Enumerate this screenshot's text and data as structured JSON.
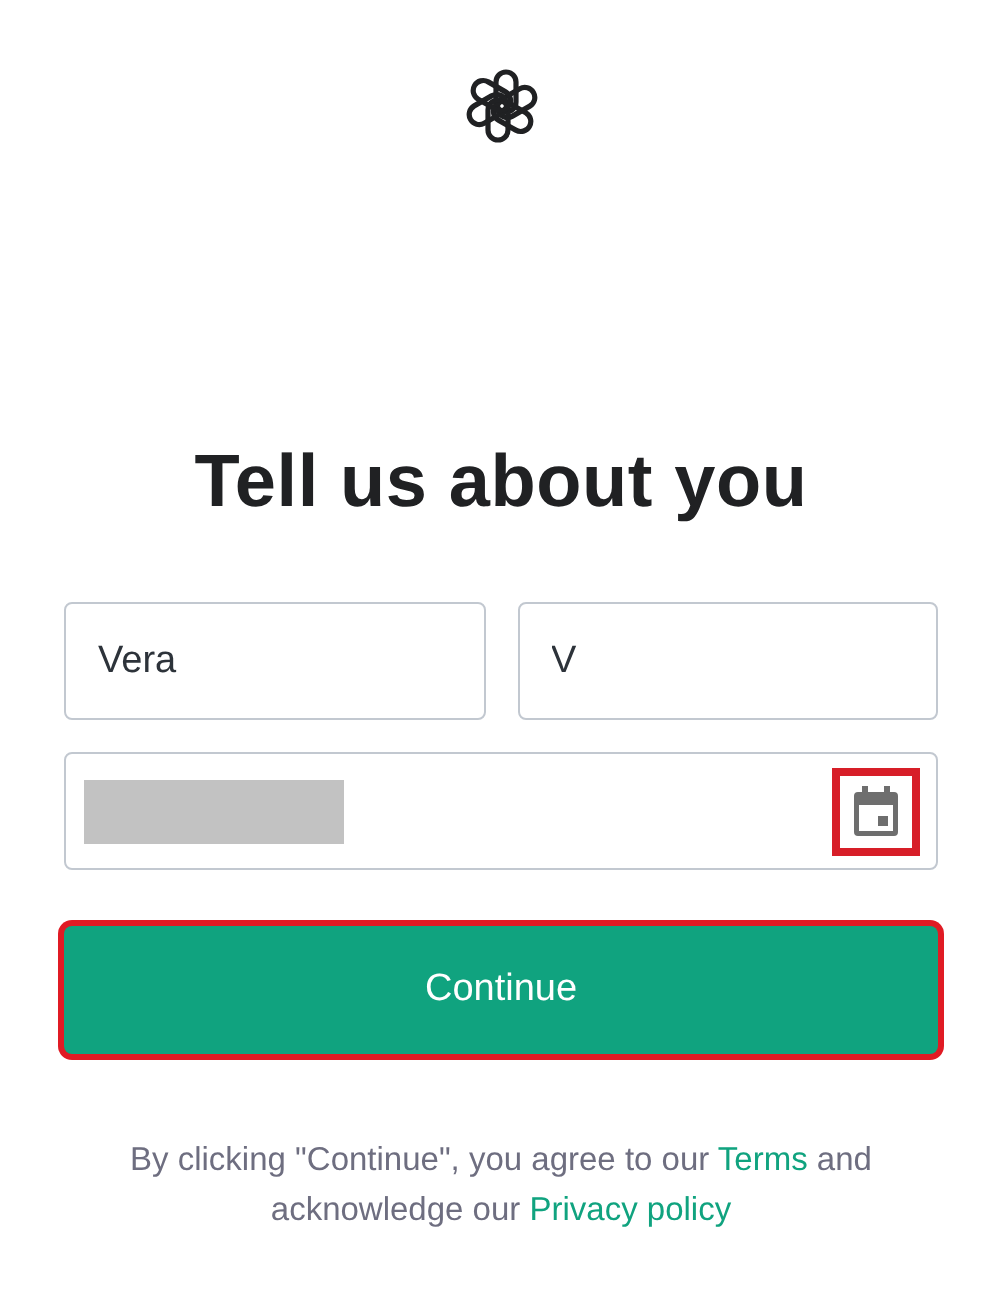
{
  "heading": "Tell us about you",
  "name_fields": [
    {
      "value": "Vera"
    },
    {
      "value": "V"
    }
  ],
  "birthday": {
    "redacted": true,
    "calendar_highlighted": true
  },
  "continue_button": {
    "label": "Continue",
    "highlighted": true
  },
  "legal": {
    "before": "By clicking \"Continue\", you agree to our ",
    "terms": "Terms",
    "middle": " and acknowledge our ",
    "privacy": "Privacy policy"
  }
}
